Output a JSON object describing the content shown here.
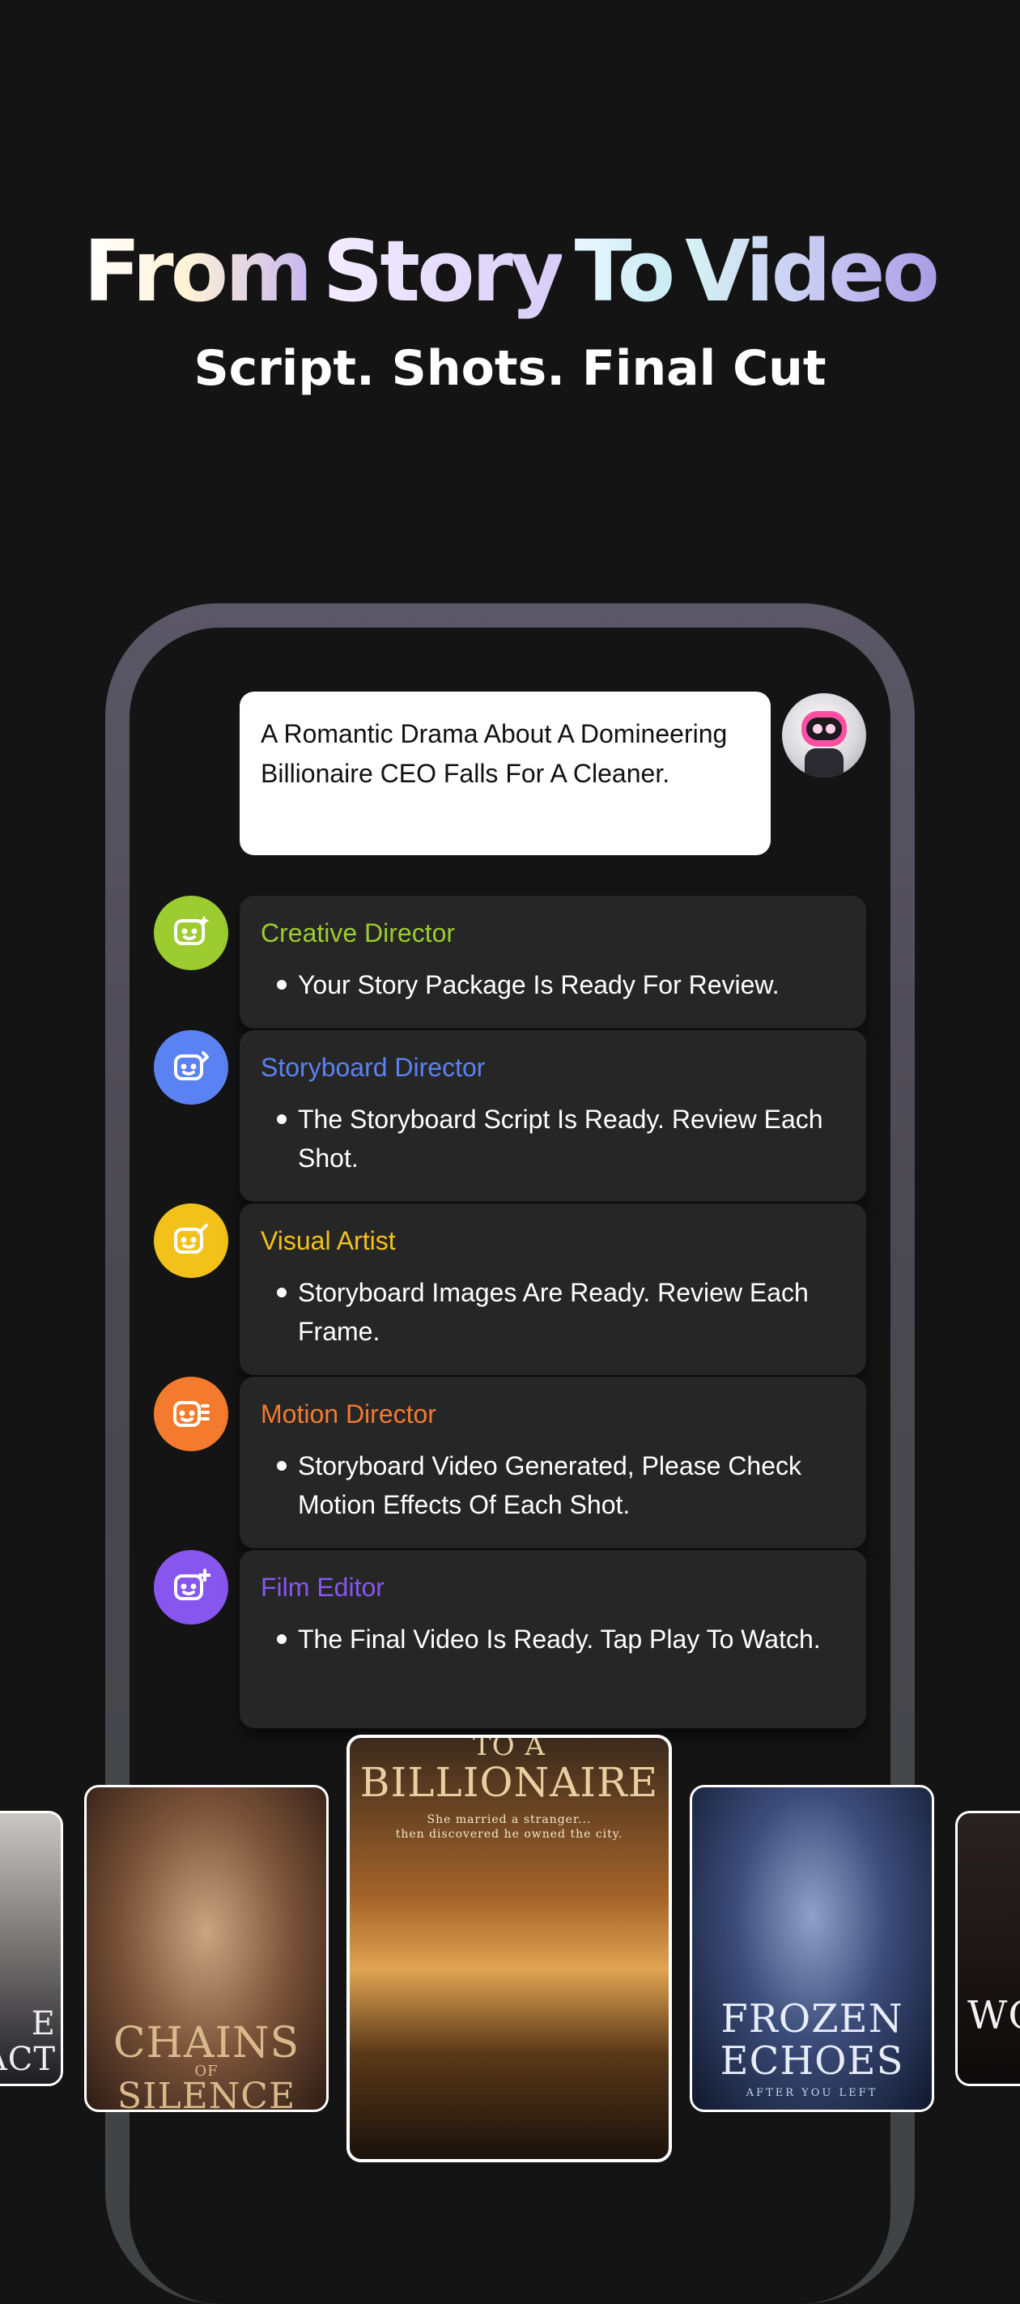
{
  "headline": {
    "words": [
      "From",
      "Story",
      "To",
      "Video"
    ],
    "subtitle": "Script. Shots. Final Cut"
  },
  "prompt": {
    "text": "A Romantic Drama About A Domineering Billionaire CEO Falls For A Cleaner."
  },
  "agents": [
    {
      "name": "Creative Director",
      "message": "Your Story Package Is Ready For Review.",
      "color": "#9ccc2f",
      "icon": "creative-director-icon"
    },
    {
      "name": "Storyboard Director",
      "message": "The Storyboard Script Is Ready. Review Each Shot.",
      "color": "#5b82f2",
      "icon": "storyboard-director-icon"
    },
    {
      "name": "Visual Artist",
      "message": "Storyboard Images Are Ready. Review Each Frame.",
      "color": "#f2c21a",
      "icon": "visual-artist-icon"
    },
    {
      "name": "Motion Director",
      "message": "Storyboard Video Generated, Please Check Motion Effects Of Each Shot.",
      "color": "#f47a2e",
      "icon": "motion-director-icon"
    },
    {
      "name": "Film Editor",
      "message": "The Final Video Is Ready. Tap Play To Watch.",
      "color": "#8656ef",
      "icon": "film-editor-icon"
    }
  ],
  "posters": {
    "left_edge": {
      "title": "E\nACT"
    },
    "chains": {
      "title": "CHAINS",
      "of": "OF",
      "title2": "SILENCE"
    },
    "billionaire": {
      "top": "TO A",
      "title": "BILLIONAIRE",
      "tagline": "She married a stranger...\nthen discovered he owned the city."
    },
    "frozen": {
      "title": "FROZEN",
      "title2": "ECHOES",
      "tagline": "AFTER YOU LEFT"
    },
    "right_edge": {
      "title": "WO"
    }
  }
}
